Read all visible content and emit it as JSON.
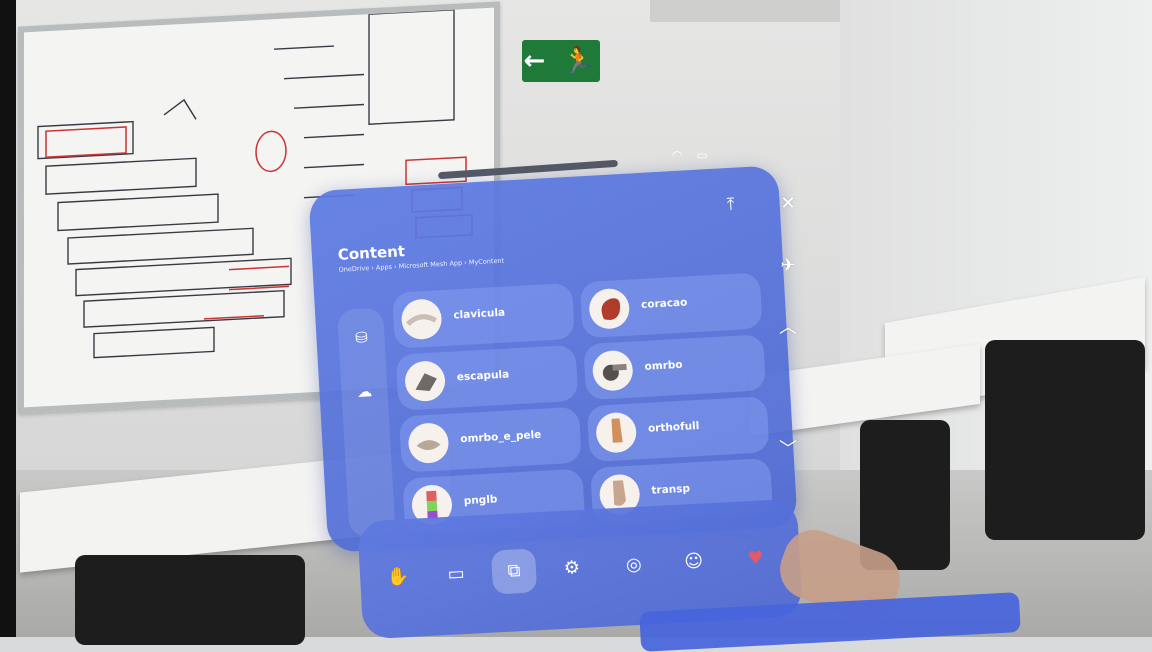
{
  "panel": {
    "title": "Content",
    "breadcrumb": "OneDrive › Apps › Microsoft Mesh App › MyContent",
    "pin_top_icon": "pin-to-top-icon"
  },
  "sidebar": {
    "items": [
      {
        "icon": "3d-objects-icon",
        "glyph": "⛁"
      },
      {
        "icon": "cloud-icon",
        "glyph": "☁"
      }
    ]
  },
  "items": [
    {
      "label": "clavicula",
      "thumb_color": "#c9bfb5"
    },
    {
      "label": "coracao",
      "thumb_color": "#b03c2b"
    },
    {
      "label": "escapula",
      "thumb_color": "#6f6a66"
    },
    {
      "label": "omrbo",
      "thumb_color": "#55504d"
    },
    {
      "label": "omrbo_e_pele",
      "thumb_color": "#b7a898"
    },
    {
      "label": "orthofull",
      "thumb_color": "#d2915c"
    },
    {
      "label": "pnglb",
      "thumb_color": "#9b4bd6"
    },
    {
      "label": "transp",
      "thumb_color": "#c8a58f"
    }
  ],
  "side_controls": {
    "close": "✕",
    "pin": "✈",
    "up": "︿",
    "down": "﹀"
  },
  "toolbar": {
    "buttons": [
      {
        "icon": "hand-menu-icon",
        "glyph": "✋"
      },
      {
        "icon": "toolbox-icon",
        "glyph": "▭"
      },
      {
        "icon": "content-icon",
        "glyph": "⧉"
      },
      {
        "icon": "settings-icon",
        "glyph": "⚙"
      },
      {
        "icon": "target-icon",
        "glyph": "◎"
      },
      {
        "icon": "avatar-icon",
        "glyph": "☺"
      },
      {
        "icon": "reaction-icon",
        "glyph": "♥"
      }
    ]
  },
  "colors": {
    "panel": "#5c7ae2",
    "accent_red": "#e05a6a"
  }
}
